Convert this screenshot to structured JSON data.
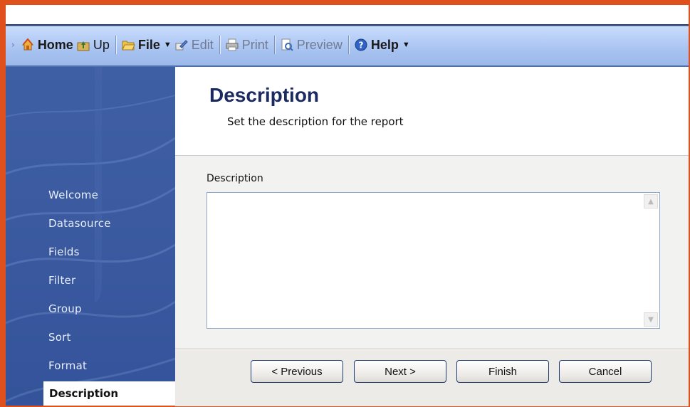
{
  "toolbar": {
    "items": [
      {
        "label": "Home",
        "icon": "home-icon"
      },
      {
        "label": "Up",
        "icon": "up-folder-icon"
      },
      {
        "label": "File",
        "icon": "folder-icon"
      },
      {
        "label": "Edit",
        "icon": "edit-icon"
      },
      {
        "label": "Print",
        "icon": "printer-icon"
      },
      {
        "label": "Preview",
        "icon": "preview-icon"
      },
      {
        "label": "Help",
        "icon": "help-icon"
      }
    ]
  },
  "sidebar": {
    "items": [
      {
        "label": "Welcome"
      },
      {
        "label": "Datasource"
      },
      {
        "label": "Fields"
      },
      {
        "label": "Filter"
      },
      {
        "label": "Group"
      },
      {
        "label": "Sort"
      },
      {
        "label": "Format"
      }
    ],
    "current": "Description"
  },
  "header": {
    "title": "Description",
    "subtitle": "Set the description for the report"
  },
  "form": {
    "description_label": "Description",
    "description_value": ""
  },
  "buttons": {
    "previous": "< Previous",
    "next": "Next >",
    "finish": "Finish",
    "cancel": "Cancel"
  },
  "colors": {
    "frame": "#e0501c",
    "sidebar": "#3b5aa0",
    "title": "#1c2a62"
  }
}
